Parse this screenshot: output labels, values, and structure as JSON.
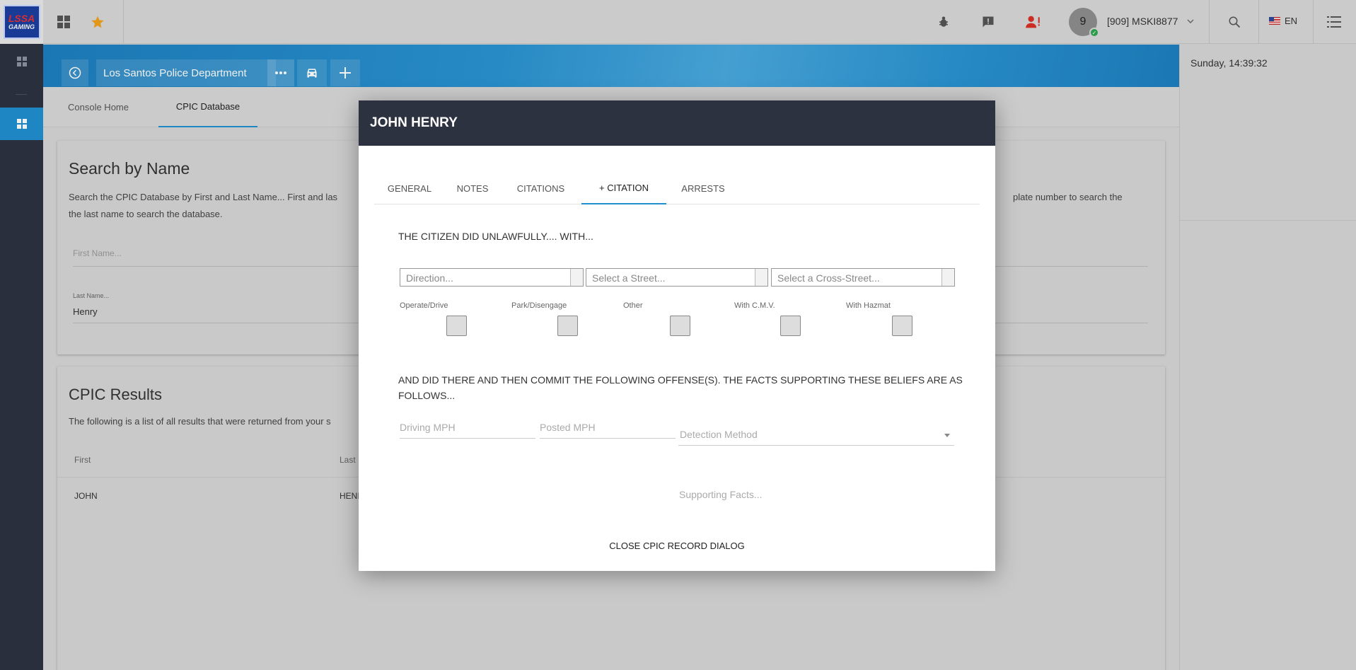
{
  "app": {
    "logo_text_top": "LSSA",
    "logo_text_bottom": "GAMING"
  },
  "topbar": {
    "icons": [
      "grid-icon",
      "star-icon",
      "bug-icon",
      "alert-message-icon",
      "user-alert-icon",
      "search-icon",
      "list-menu-icon"
    ],
    "avatar_count": "9",
    "user_label": "[909] MSKI8877",
    "language": "EN",
    "colors": {
      "star": "#f0a21c",
      "user_alert": "#d93025"
    }
  },
  "header": {
    "department": "Los Santos Police Department"
  },
  "tabs": {
    "console_home": "Console Home",
    "cpic_database": "CPIC Database"
  },
  "right_panel": {
    "clock": "Sunday, 14:39:32"
  },
  "search_card": {
    "title": "Search by Name",
    "description_left": "Search the CPIC Database by First and Last Name... First and las",
    "description_right": "plate number to search the",
    "description_line2": "the last name to search the database.",
    "first_name_placeholder": "First Name...",
    "last_name_label": "Last Name...",
    "last_name_value": "Henry"
  },
  "results_card": {
    "title": "CPIC Results",
    "description": "The following is a list of all results that were returned from your s",
    "columns": [
      "First",
      "Last"
    ],
    "rows": [
      {
        "first": "JOHN",
        "last": "HENI"
      }
    ]
  },
  "modal": {
    "title": "JOHN HENRY",
    "tabs": [
      "GENERAL",
      "NOTES",
      "CITATIONS",
      "+ CITATION",
      "ARRESTS"
    ],
    "active_tab": "+ CITATION",
    "unlawful_text": "THE CITIZEN DID UNLAWFULLY.... WITH...",
    "selects": {
      "direction": "Direction...",
      "street": "Select a Street...",
      "cross_street": "Select a Cross-Street..."
    },
    "checkboxes": [
      "Operate/Drive",
      "Park/Disengage",
      "Other",
      "With C.M.V.",
      "With Hazmat"
    ],
    "offense_text": "AND DID THERE AND THEN COMMIT THE FOLLOWING OFFENSE(S). THE FACTS SUPPORTING THESE BELIEFS ARE AS FOLLOWS...",
    "fields": {
      "driving_mph": "Driving MPH",
      "posted_mph": "Posted MPH",
      "detection_method": "Detection Method",
      "supporting_facts": "Supporting Facts..."
    },
    "close_label": "CLOSE CPIC RECORD DIALOG"
  }
}
